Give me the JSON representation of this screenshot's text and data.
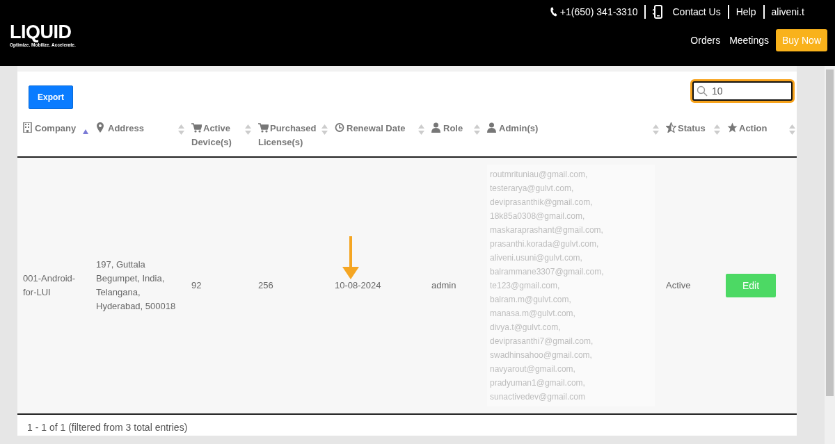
{
  "header": {
    "logo": {
      "word": "LIQUID",
      "tagline": "Optimize. Mobilize. Accelerate."
    },
    "top_links": [
      {
        "kind": "phone",
        "label": "+1(650) 341-3310"
      },
      {
        "kind": "contact",
        "label": "Contact Us"
      },
      {
        "kind": "plain",
        "label": "Help"
      },
      {
        "kind": "plain",
        "label": "aliveni.t"
      }
    ],
    "nav": [
      {
        "kind": "link",
        "label": "Orders"
      },
      {
        "kind": "link",
        "label": "Meetings"
      },
      {
        "kind": "button",
        "label": "Buy Now"
      }
    ]
  },
  "toolbar": {
    "export_button": "Export",
    "search": {
      "value": "10"
    }
  },
  "table": {
    "columns": [
      {
        "label": "Company",
        "sorted": true
      },
      {
        "label": "Address",
        "sorted": false
      },
      {
        "label": "Active Device(s)",
        "sorted": false
      },
      {
        "label": "Purchased License(s)",
        "sorted": false
      },
      {
        "label": "Renewal Date",
        "sorted": false
      },
      {
        "label": "Role",
        "sorted": false
      },
      {
        "label": "Admin(s)",
        "sorted": false
      },
      {
        "label": "Status",
        "sorted": false
      },
      {
        "label": "Action",
        "sorted": false
      }
    ],
    "rows": [
      {
        "company": "001-Android-for-LUI",
        "address": "197, Guttala Begumpet, India, Telangana, Hyderabad, 500018",
        "active_devices": "92",
        "purchased_licenses": "256",
        "renewal_date": "10-08-2024",
        "role": "admin",
        "admins": [
          "routmrituniau@gmail.com,",
          "testerarya@gulvt.com,",
          "deviprasanthik@gmail.com,",
          "18k85a0308@gmail.com,",
          "maskaraprashant@gmail.com,",
          "prasanthi.korada@gulvt.com,",
          "aliveni.usuni@gulvt.com,",
          "balrammane3307@gmail.com,",
          "te123@gmail.com,",
          "balram.m@gulvt.com,",
          "manasa.m@gulvt.com,",
          "divya.t@gulvt.com,",
          "deviprasanthi7@gmail.com,",
          "swadhinsahoo@gmail.com,",
          "navyarout@gmail.com,",
          "pradyuman1@gmail.com,",
          "sunactivedev@gmail.com"
        ],
        "status": "Active",
        "action": "Edit"
      }
    ]
  },
  "footer": {
    "summary": "1 - 1 of 1 (filtered from 3 total entries)"
  }
}
